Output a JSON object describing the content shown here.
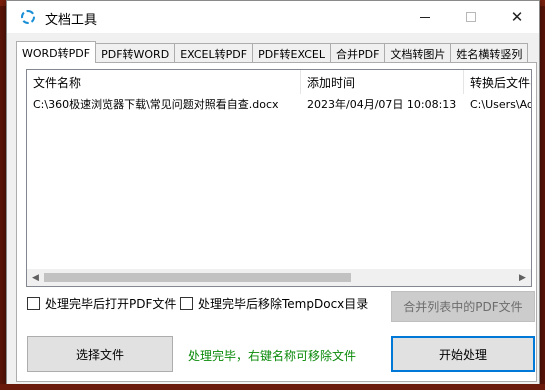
{
  "window": {
    "title": "文档工具",
    "min_glyph": "—",
    "max_glyph": "☐",
    "close_glyph": "✕"
  },
  "tabs": [
    {
      "label": "WORD转PDF",
      "active": true
    },
    {
      "label": "PDF转WORD"
    },
    {
      "label": "EXCEL转PDF"
    },
    {
      "label": "PDF转EXCEL"
    },
    {
      "label": "合并PDF"
    },
    {
      "label": "文档转图片"
    },
    {
      "label": "姓名横转竖列"
    }
  ],
  "list": {
    "columns": [
      "文件名称",
      "添加时间",
      "转换后文件名"
    ],
    "rows": [
      [
        "C:\\360极速浏览器下载\\常见问题对照看自查.docx",
        "2023年/04月/07日 10:08:13",
        "C:\\Users\\Ad"
      ]
    ]
  },
  "options": {
    "open_pdf_after": "处理完毕后打开PDF文件",
    "remove_tempdocx_after": "处理完毕后移除TempDocx目录"
  },
  "buttons": {
    "merge": "合并列表中的PDF文件",
    "select_file": "选择文件",
    "start": "开始处理"
  },
  "status": "处理完毕，右键名称可移除文件",
  "icons": {
    "app": "spinner-icon",
    "scroll_left": "chevron-left-icon",
    "scroll_right": "chevron-right-icon"
  },
  "colors": {
    "status_text": "#0a8a0a",
    "primary_border": "#0078d7",
    "app_icon": "#1a8fd6"
  }
}
